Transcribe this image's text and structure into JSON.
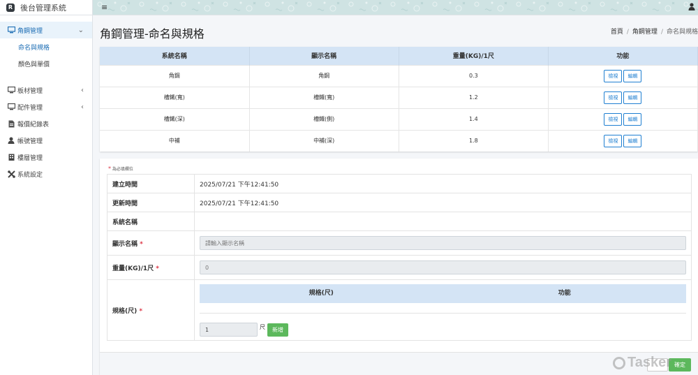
{
  "app": {
    "brand_letter": "R",
    "title": "後台管理系統"
  },
  "sidebar": {
    "groups": [
      {
        "label": "角鋼管理",
        "chevron": "⌄",
        "sub": [
          {
            "label": "命名與規格"
          },
          {
            "label": "顏色與單價"
          }
        ]
      },
      {
        "label": "板材管理",
        "chevron": "‹"
      },
      {
        "label": "配件管理",
        "chevron": "‹"
      },
      {
        "label": "報價紀錄表"
      },
      {
        "label": "帳號管理"
      },
      {
        "label": "樓層管理"
      },
      {
        "label": "系統設定"
      }
    ]
  },
  "topbar": {
    "menu_icon": "≡"
  },
  "header": {
    "title": "角鋼管理-命名與規格",
    "breadcrumb": [
      "首頁",
      "角鋼管理",
      "命名與規格"
    ]
  },
  "list": {
    "columns": [
      "系統名稱",
      "顯示名稱",
      "重量(KG)/1尺",
      "功能"
    ],
    "rows": [
      {
        "system": "角鋼",
        "display": "角鋼",
        "weight": "0.3"
      },
      {
        "system": "槽鐵(寬)",
        "display": "槽鐵(寬)",
        "weight": "1.2"
      },
      {
        "system": "槽鐵(深)",
        "display": "槽鐵(側)",
        "weight": "1.4"
      },
      {
        "system": "中補",
        "display": "中補(深)",
        "weight": "1.8"
      }
    ],
    "view_label": "檢視",
    "edit_label": "編輯"
  },
  "form": {
    "required_note": "為必填欄位",
    "created_label": "建立時間",
    "created_value": "2025/07/21 下午12:41:50",
    "updated_label": "更新時間",
    "updated_value": "2025/07/21 下午12:41:50",
    "system_name_label": "系統名稱",
    "display_name_label": "顯示名稱",
    "display_name_placeholder": "請輸入顯示名稱",
    "weight_label": "重量(KG)/1尺",
    "weight_value": "0",
    "spec_label": "規格(尺)",
    "spec_columns": [
      "規格(尺)",
      "功能"
    ],
    "spec_input_value": "1",
    "spec_unit": "尺",
    "add_label": "新增",
    "save_label": "確定"
  },
  "watermark": "Tasker",
  "colors": {
    "accent": "#1f7fd1",
    "header_blue": "#d4e4f5",
    "green": "#5cb85c",
    "required": "#dc3545"
  }
}
